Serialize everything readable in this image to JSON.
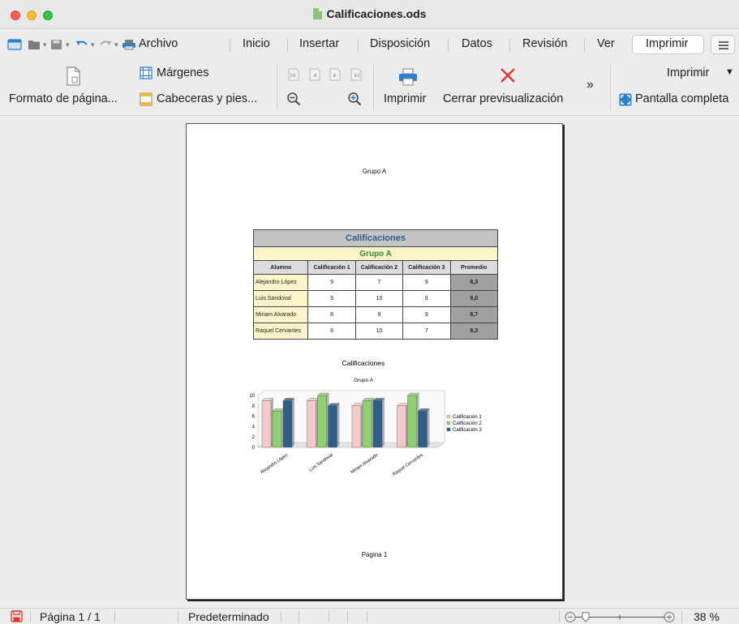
{
  "window": {
    "title": "Calificaciones.ods"
  },
  "menu": {
    "items": [
      "Archivo",
      "Inicio",
      "Insertar",
      "Disposición",
      "Datos",
      "Revisión",
      "Ver",
      "Imprimir"
    ],
    "active": "Imprimir"
  },
  "toolbar": {
    "page_format": "Formato de página...",
    "margins": "Márgenes",
    "headers_footers": "Cabeceras y pies...",
    "print": "Imprimir",
    "close_preview": "Cerrar previsualización",
    "overflow": "»",
    "print_menu": "Imprimir",
    "full_screen": "Pantalla completa"
  },
  "page": {
    "header": "Grupo A",
    "footer": "Página 1",
    "table": {
      "title": "Calificaciones",
      "group": "Grupo A",
      "headers": [
        "Alumno",
        "Calificación 1",
        "Calificación 2",
        "Calificación 3",
        "Promedio"
      ],
      "rows": [
        [
          "Alejandro López",
          "9",
          "7",
          "9",
          "8,3"
        ],
        [
          "Luis Sandoval",
          "9",
          "10",
          "8",
          "9,0"
        ],
        [
          "Miriam Alvarado",
          "8",
          "9",
          "9",
          "8,7"
        ],
        [
          "Raquel Cervantes",
          "8",
          "10",
          "7",
          "8,3"
        ]
      ]
    }
  },
  "chart_data": {
    "type": "bar",
    "title": "Calificaciones",
    "subtitle": "Grupo A",
    "categories": [
      "Alejandro López",
      "Luis Sandoval",
      "Miriam Alvarado",
      "Raquel Cervantes"
    ],
    "series": [
      {
        "name": "Calificación 1",
        "values": [
          9,
          9,
          8,
          8
        ],
        "color": "#f4c9cc"
      },
      {
        "name": "Calificación 2",
        "values": [
          7,
          10,
          9,
          10
        ],
        "color": "#8fd16e"
      },
      {
        "name": "Calificación 3",
        "values": [
          9,
          8,
          9,
          7
        ],
        "color": "#2e5f8a"
      }
    ],
    "yticks": [
      "10",
      "8",
      "6",
      "4",
      "2",
      "0"
    ],
    "ylim": [
      0,
      10
    ],
    "legend": "right",
    "grid": false
  },
  "statusbar": {
    "page": "Página 1 / 1",
    "style": "Predeterminado",
    "zoom": "38 %"
  },
  "colors": {
    "close_red": "#e23b2e",
    "accent_blue": "#2a7fd0"
  }
}
